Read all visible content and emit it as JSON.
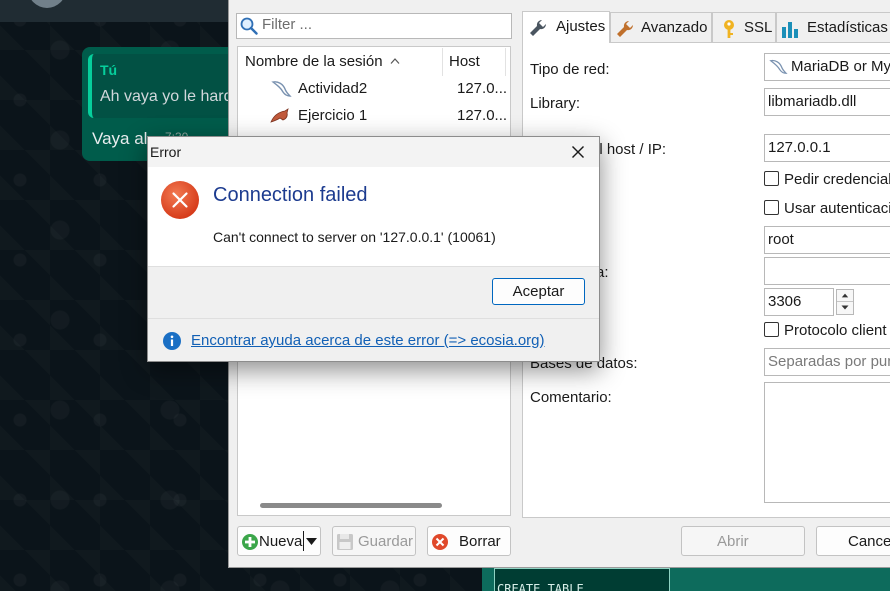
{
  "whatsapp": {
    "quote_author": "Tú",
    "quote_text": "Ah vaya yo le hard",
    "message": "Vaya al",
    "time": "7:30"
  },
  "background_window": {
    "code_text": "CREATE TABLE"
  },
  "session_manager": {
    "filter_placeholder": "Filter ...",
    "columns": {
      "name": "Nombre de la sesión",
      "sort_indicator": "^",
      "host": "Host"
    },
    "sessions": [
      {
        "name": "Actividad2",
        "host": "127.0...",
        "icon": "mariadb-dolphin-icon"
      },
      {
        "name": "Ejercicio 1",
        "host": "127.0...",
        "icon": "mysql-dolphin-icon"
      }
    ],
    "buttons": {
      "new": "Nueva",
      "save": "Guardar",
      "delete": "Borrar",
      "open": "Abrir",
      "cancel": "Cancel"
    },
    "tabs": [
      {
        "label": "Ajustes",
        "icon": "wrench-icon",
        "active": true
      },
      {
        "label": "Avanzado",
        "icon": "wrench-icon",
        "active": false
      },
      {
        "label": "SSL",
        "icon": "key-icon",
        "active": false
      },
      {
        "label": "Estadísticas",
        "icon": "bar-chart-icon",
        "active": false
      }
    ],
    "settings": {
      "network_type_label": "Tipo de red:",
      "network_type_value": "MariaDB or My",
      "library_label": "Library:",
      "library_value": "libmariadb.dll",
      "host_label": "el host / IP:",
      "host_value": "127.0.0.1",
      "prompt_credentials": "Pedir credencial",
      "use_auth": "Usar autenticacio",
      "user_value": "root",
      "password_label": "a:",
      "port_value": "3306",
      "compressed_protocol": "Protocolo client",
      "databases_label": "Bases de datos:",
      "databases_placeholder": "Separadas por pun",
      "comment_label": "Comentario:"
    }
  },
  "error_dialog": {
    "title": "Error",
    "heading": "Connection failed",
    "message": "Can't connect to server on '127.0.0.1' (10061)",
    "ok_button": "Aceptar",
    "help_link": "Encontrar ayuda acerca de este error (=> ecosia.org)",
    "error_color": "#e0492b",
    "accent_color": "#0067c0"
  }
}
